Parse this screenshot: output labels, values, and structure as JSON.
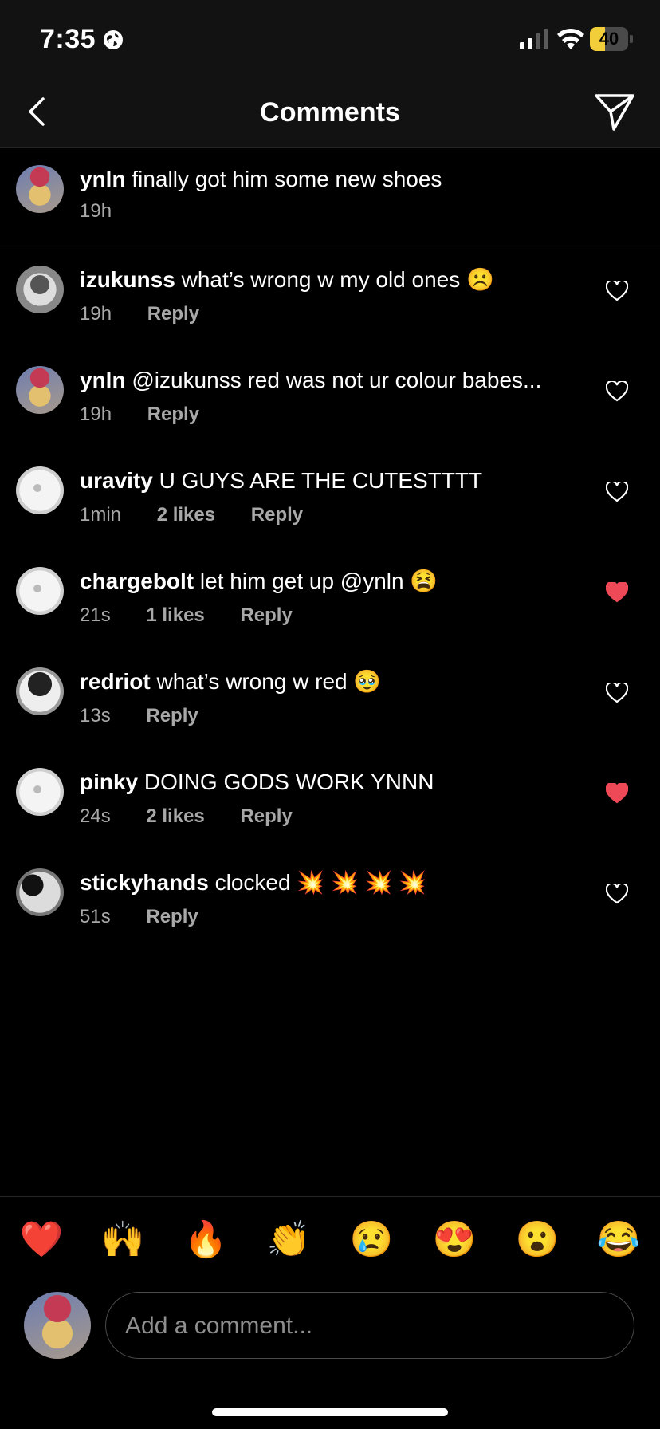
{
  "status": {
    "time": "7:35",
    "battery": "40",
    "battery_level_pct": 40
  },
  "nav": {
    "title": "Comments"
  },
  "caption": {
    "user": "ynln",
    "text": "finally got him some new shoes",
    "time": "19h"
  },
  "comments": [
    {
      "user": "izukunss",
      "text": "what’s wrong w my old ones ☹️",
      "time": "19h",
      "likes": "",
      "reply": "Reply",
      "liked": false
    },
    {
      "user": "ynln",
      "text": "@izukunss red was not ur colour babes...",
      "time": "19h",
      "likes": "",
      "reply": "Reply",
      "liked": false
    },
    {
      "user": "uravity",
      "text": "U GUYS ARE THE CUTESTTTT",
      "time": "1min",
      "likes": "2 likes",
      "reply": "Reply",
      "liked": false
    },
    {
      "user": "chargebolt",
      "text": "let him get up @ynln 😫",
      "time": "21s",
      "likes": "1 likes",
      "reply": "Reply",
      "liked": true
    },
    {
      "user": "redriot",
      "text": "what’s wrong w red 🥹",
      "time": "13s",
      "likes": "",
      "reply": "Reply",
      "liked": false
    },
    {
      "user": "pinky",
      "text": "DOING GODS WORK YNNN",
      "time": "24s",
      "likes": "2 likes",
      "reply": "Reply",
      "liked": true
    },
    {
      "user": "stickyhands",
      "text": "clocked 💥 💥 💥 💥",
      "time": "51s",
      "likes": "",
      "reply": "Reply",
      "liked": false
    }
  ],
  "reactions": [
    "❤️",
    "🙌",
    "🔥",
    "👏",
    "😢",
    "😍",
    "😮",
    "😂"
  ],
  "compose": {
    "placeholder": "Add a comment..."
  },
  "colors": {
    "liked_heart": "#ed4956",
    "background": "#000000",
    "header": "#121212",
    "battery": "#f2cf3a"
  },
  "icons": [
    "globe-icon",
    "signal-icon",
    "wifi-icon",
    "battery-icon",
    "back-chevron-icon",
    "send-icon",
    "heart-icon"
  ]
}
